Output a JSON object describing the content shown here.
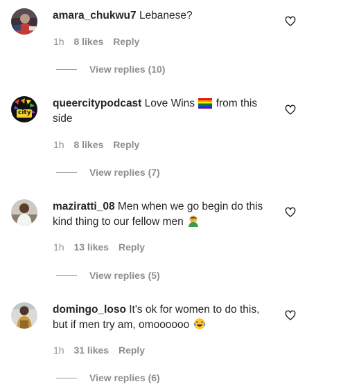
{
  "comments": [
    {
      "username": "amara_chukwu7",
      "text_before": "Lebanese?",
      "text_after": "",
      "emoji": "",
      "time": "1h",
      "likes": "8 likes",
      "reply": "Reply",
      "view_replies": "View replies (10)"
    },
    {
      "username": "queercitypodcast",
      "text_before": "Love Wins",
      "text_after": "from this side",
      "emoji": "rainbow-flag",
      "time": "1h",
      "likes": "8 likes",
      "reply": "Reply",
      "view_replies": "View replies (7)",
      "avatar_text": "city"
    },
    {
      "username": "maziratti_08",
      "text_before": "Men when we go begin do this kind thing to our fellow men",
      "text_after": "",
      "emoji": "facepalm",
      "time": "1h",
      "likes": "13 likes",
      "reply": "Reply",
      "view_replies": "View replies (5)"
    },
    {
      "username": "domingo_loso",
      "text_before": "It's ok for women to do this, but if men try am, omoooooo",
      "text_after": "",
      "emoji": "tears-of-joy",
      "time": "1h",
      "likes": "31 likes",
      "reply": "Reply",
      "view_replies": "View replies (6)"
    }
  ],
  "icons": {
    "like": "heart-outline-icon"
  },
  "colors": {
    "text": "#262626",
    "muted": "#8e8e8e"
  }
}
